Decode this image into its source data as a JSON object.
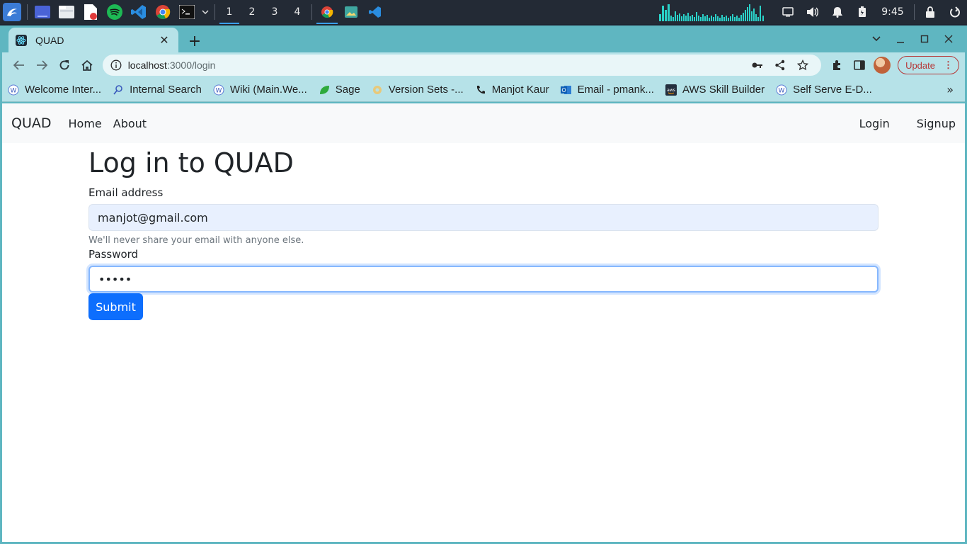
{
  "taskbar": {
    "workspaces": [
      "1",
      "2",
      "3",
      "4"
    ],
    "clock": "9:45",
    "accent": "#3aa0ff"
  },
  "browser": {
    "tab_title": "QUAD",
    "url_host": "localhost",
    "url_path": ":3000/login",
    "update_label": "Update",
    "bookmarks": [
      {
        "label": "Welcome Inter...",
        "icon": "wiki-icon"
      },
      {
        "label": "Internal Search",
        "icon": "search-icon"
      },
      {
        "label": "Wiki (Main.We...",
        "icon": "wiki-icon"
      },
      {
        "label": "Sage",
        "icon": "leaf-icon"
      },
      {
        "label": "Version Sets -...",
        "icon": "gear-icon"
      },
      {
        "label": "Manjot Kaur",
        "icon": "phone-icon"
      },
      {
        "label": "Email - pmank...",
        "icon": "outlook-icon"
      },
      {
        "label": "AWS Skill Builder",
        "icon": "aws-icon"
      },
      {
        "label": "Self Serve E-D...",
        "icon": "wiki-icon"
      }
    ]
  },
  "navbar": {
    "brand": "QUAD",
    "links": [
      "Home",
      "About"
    ],
    "right_links": [
      "Login",
      "Signup"
    ]
  },
  "form": {
    "title": "Log in to QUAD",
    "email_label": "Email address",
    "email_value": "manjot@gmail.com",
    "email_help": "We'll never share your email with anyone else.",
    "password_label": "Password",
    "password_value": "•••••",
    "submit_label": "Submit",
    "primary_color": "#0d6efd"
  }
}
